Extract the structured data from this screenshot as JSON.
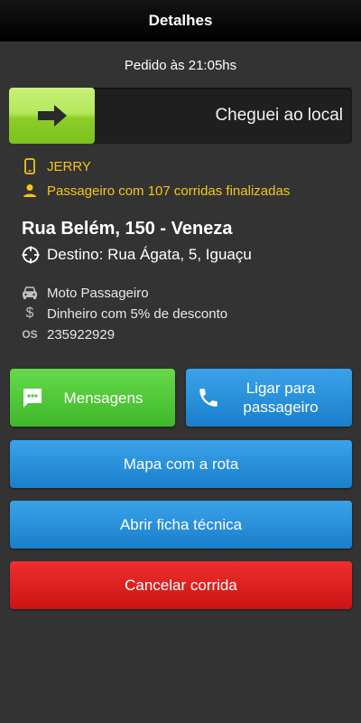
{
  "header": {
    "title": "Detalhes"
  },
  "order": {
    "time_text": "Pedido às 21:05hs"
  },
  "slider": {
    "label": "Cheguei ao local"
  },
  "passenger": {
    "name": "JERRY",
    "rides_text": "Passageiro com 107 corridas finalizadas"
  },
  "route": {
    "address": "Rua Belém, 150 - Veneza",
    "destination": "Destino: Rua Ágata, 5, Iguaçu"
  },
  "ride": {
    "vehicle_type": "Moto Passageiro",
    "payment": "Dinheiro com 5% de desconto",
    "os_label": "OS",
    "os_number": "235922929"
  },
  "actions": {
    "messages_label": "Mensagens",
    "call_label_line1": "Ligar para",
    "call_label_line2": "passageiro",
    "map_label": "Mapa com a rota",
    "sheet_label": "Abrir ficha técnica",
    "cancel_label": "Cancelar corrida"
  },
  "colors": {
    "background": "#333333",
    "accent_yellow": "#f5c518",
    "green": "#4cc636",
    "blue": "#2390dc",
    "red": "#dd1f1f"
  },
  "icons": {
    "slider": "arrow-right-icon",
    "name": "phone-icon",
    "rides": "person-icon",
    "destination": "crosshair-icon",
    "vehicle": "car-icon",
    "payment": "dollar-icon",
    "messages": "chat-icon",
    "call": "phone-handset-icon"
  }
}
